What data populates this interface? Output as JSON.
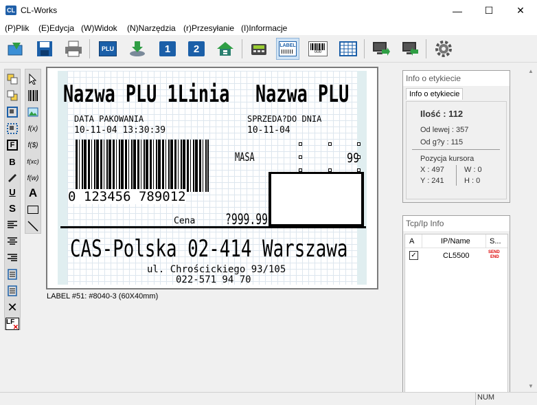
{
  "window": {
    "icon_text": "CL",
    "title": "CL-Works",
    "minimize": "—",
    "maximize": "☐",
    "close": "✕"
  },
  "menu": [
    "(P)Plik",
    "(E)Edycja",
    "(W)Widok",
    "(N)Narzędzia",
    "(r)Przesyłanie",
    "(I)Informacje"
  ],
  "toolbar": {
    "plu": "PLU",
    "one": "1",
    "two": "2",
    "label": "LABEL",
    "barcode_digits": "000"
  },
  "tools": {
    "bold": "B",
    "underline": "U",
    "strike": "S",
    "text_a": "A",
    "fx1": "f(x)",
    "fx2": "f($)",
    "fx3": "f(xc)",
    "fx4": "f(w)",
    "lf": "LF"
  },
  "label": {
    "line1_a": "Nazwa PLU 1Linia",
    "line1_b": "Nazwa PLU",
    "pack_date_label": "DATA PAKOWANIA",
    "pack_date_value": "10-11-04  13:30:39",
    "sell_by_label": "SPRZEDA?DO DNIA",
    "sell_by_value": "10-11-04",
    "barcode_number": "0 123456 789012",
    "mass_label": "MASA",
    "mass_value": "99",
    "price_label": "Cena",
    "price_value": "?999.99",
    "company": "CAS-Polska 02-414 Warszawa",
    "street": "ul. Chrościckiego 93/105",
    "phone": "022-571 94 70"
  },
  "status_label": "LABEL #51: #8040-3 (60X40mm)",
  "info_panel": {
    "title": "Info o etykiecie",
    "tab": "Info o etykiecie",
    "qty": "Ilość : 112",
    "from_left": "Od lewej : 357",
    "from_top": "Od g?y : 115",
    "cursor_title": "Pozycja kursora",
    "x": "X : 497",
    "y": "Y : 241",
    "w": "W : 0",
    "h": "H : 0"
  },
  "tcp_panel": {
    "title": "Tcp/Ip Info",
    "col_a": "A",
    "col_ip": "IP/Name",
    "col_s": "S...",
    "row_name": "CL5500",
    "row_send": "SEND",
    "row_end": "END"
  },
  "statusbar": {
    "num": "NUM"
  }
}
